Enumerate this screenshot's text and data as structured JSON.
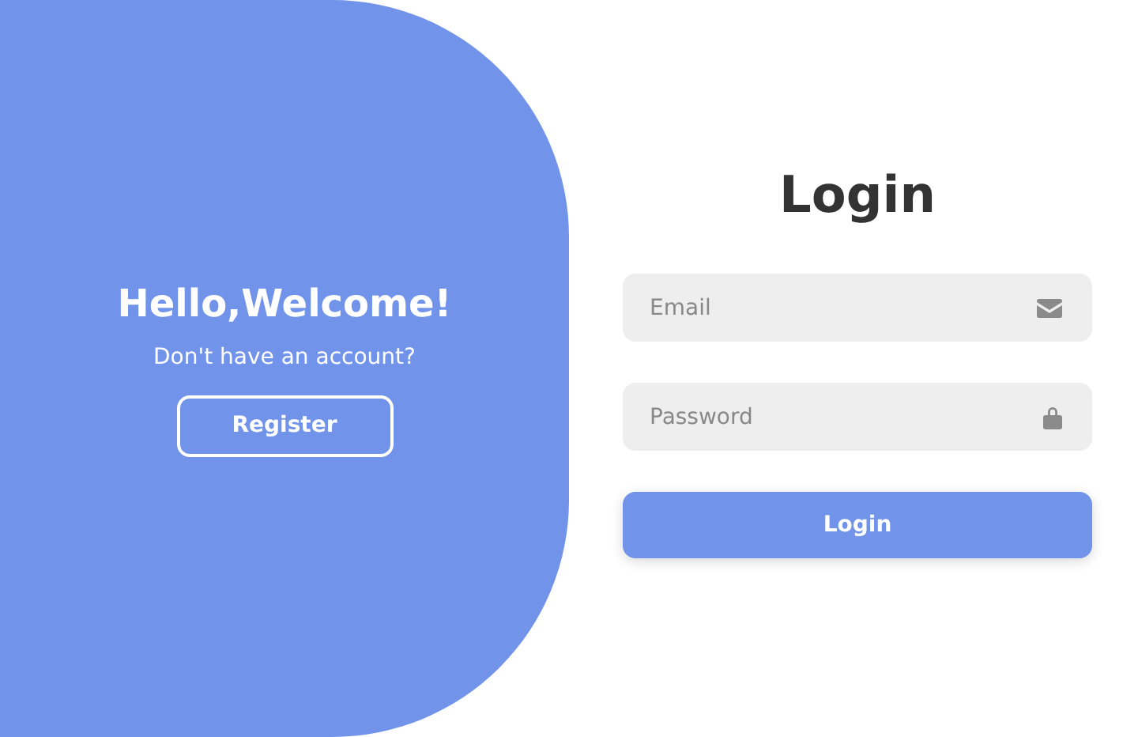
{
  "welcome": {
    "title": "Hello,Welcome!",
    "subtitle": "Don't have an account?",
    "button": "Register"
  },
  "login": {
    "title": "Login",
    "fields": [
      {
        "kind": "email",
        "placeholder": "Email"
      },
      {
        "kind": "password",
        "placeholder": "Password"
      }
    ],
    "button": "Login"
  }
}
